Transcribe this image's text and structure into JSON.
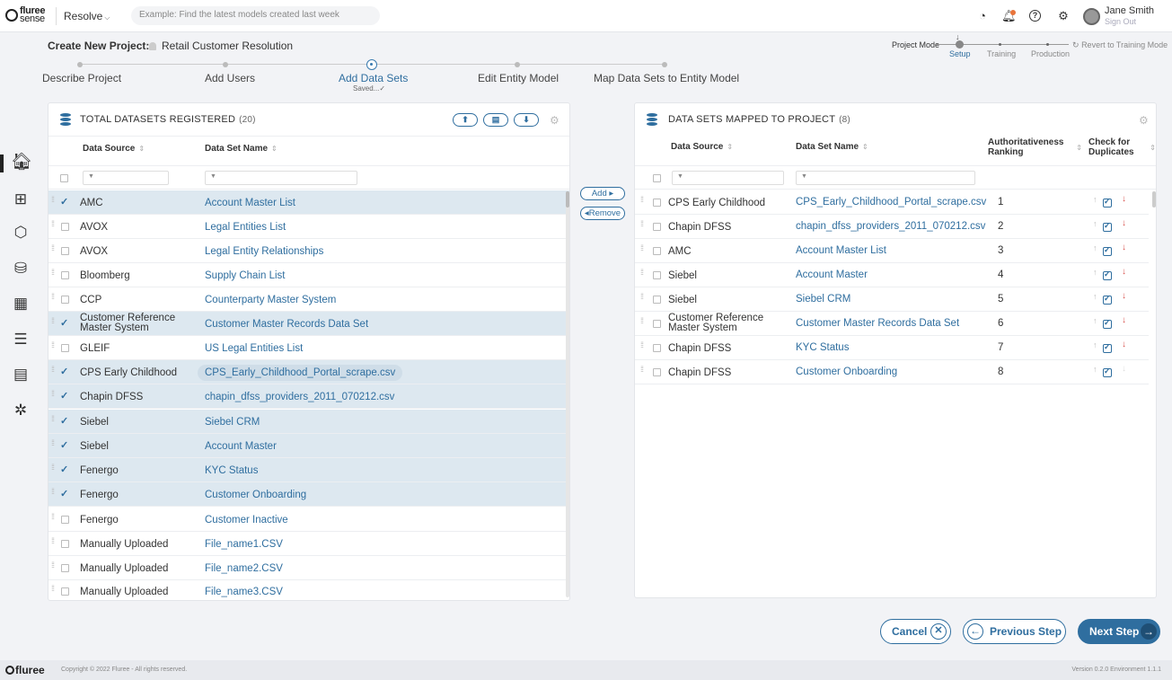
{
  "header": {
    "logo_line1": "fluree",
    "logo_line2": "sense",
    "app_name": "Resolve",
    "search_placeholder": "Example: Find the latest models created last week",
    "user_name": "Jane Smith",
    "sign_out": "Sign Out"
  },
  "project": {
    "title_label": "Create New Project:",
    "name": "Retail Customer Resolution",
    "mode_label": "Project Mode",
    "modes": [
      "Setup",
      "Training",
      "Production"
    ],
    "active_mode": "Setup",
    "revert_label": "Revert to Training Mode"
  },
  "stepper": {
    "steps": [
      "Describe Project",
      "Add Users",
      "Add Data Sets",
      "Edit Entity Model",
      "Map Data Sets to Entity Model"
    ],
    "active_step": "Add Data Sets",
    "active_status": "Saved..."
  },
  "sidebar": {
    "items": [
      "home-icon",
      "grid-icon",
      "cube-icon",
      "database-icon",
      "calculator-icon",
      "checklist-icon",
      "table-icon",
      "settings-icon"
    ],
    "active": "home-icon"
  },
  "left_panel": {
    "title": "TOTAL DATASETS REGISTERED",
    "count": "(20)",
    "columns": [
      "Data Source",
      "Data Set Name"
    ],
    "rows": [
      {
        "source": "AMC",
        "name": "Account Master List",
        "checked": true,
        "selected": true
      },
      {
        "source": "AVOX",
        "name": "Legal Entities List",
        "checked": false,
        "selected": false
      },
      {
        "source": "AVOX",
        "name": "Legal Entity Relationships",
        "checked": false,
        "selected": false
      },
      {
        "source": "Bloomberg",
        "name": "Supply Chain List",
        "checked": false,
        "selected": false
      },
      {
        "source": "CCP",
        "name": "Counterparty Master System",
        "checked": false,
        "selected": false
      },
      {
        "source": "Customer Reference Master System",
        "name": "Customer Master Records Data Set",
        "checked": true,
        "selected": true
      },
      {
        "source": "GLEIF",
        "name": "US Legal Entities List",
        "checked": false,
        "selected": false
      },
      {
        "source": "CPS Early Childhood",
        "name": "CPS_Early_Childhood_Portal_scrape.csv",
        "checked": true,
        "selected": true
      },
      {
        "source": "Chapin DFSS",
        "name": "chapin_dfss_providers_2011_070212.csv",
        "checked": true,
        "selected": true
      },
      {
        "source": "Siebel",
        "name": "Siebel CRM",
        "checked": true,
        "selected": true
      },
      {
        "source": "Siebel",
        "name": "Account Master",
        "checked": true,
        "selected": true
      },
      {
        "source": "Fenergo",
        "name": "KYC Status",
        "checked": true,
        "selected": true
      },
      {
        "source": "Fenergo",
        "name": "Customer Onboarding",
        "checked": true,
        "selected": true
      },
      {
        "source": "Fenergo",
        "name": "Customer Inactive",
        "checked": false,
        "selected": false
      },
      {
        "source": "Manually Uploaded",
        "name": "File_name1.CSV",
        "checked": false,
        "selected": false
      },
      {
        "source": "Manually Uploaded",
        "name": "File_name2.CSV",
        "checked": false,
        "selected": false
      },
      {
        "source": "Manually Uploaded",
        "name": "File_name3.CSV",
        "checked": false,
        "selected": false
      }
    ]
  },
  "transfer": {
    "add_label": "Add",
    "remove_label": "Remove"
  },
  "right_panel": {
    "title": "DATA SETS MAPPED TO PROJECT",
    "count": "(8)",
    "columns": [
      "Data Source",
      "Data Set Name",
      "Authoritativeness Ranking",
      "Check for Duplicates"
    ],
    "rows": [
      {
        "source": "CPS Early Childhood",
        "name": "CPS_Early_Childhood_Portal_scrape.csv",
        "rank": "1"
      },
      {
        "source": "Chapin DFSS",
        "name": "chapin_dfss_providers_2011_070212.csv",
        "rank": "2"
      },
      {
        "source": "AMC",
        "name": "Account Master List",
        "rank": "3"
      },
      {
        "source": "Siebel",
        "name": "Account Master",
        "rank": "4"
      },
      {
        "source": "Siebel",
        "name": "Siebel CRM",
        "rank": "5"
      },
      {
        "source": "Customer Reference Master System",
        "name": "Customer Master Records Data Set",
        "rank": "6"
      },
      {
        "source": "Chapin DFSS",
        "name": "KYC Status",
        "rank": "7"
      },
      {
        "source": "Chapin DFSS",
        "name": "Customer Onboarding",
        "rank": "8"
      }
    ]
  },
  "footer_buttons": {
    "cancel": "Cancel",
    "previous": "Previous Step",
    "next": "Next Step"
  },
  "bottom": {
    "brand": "fluree",
    "copyright": "Copyright © 2022 Fluree - All rights reserved.",
    "version": "Version 0.2.0   Environment 1.1.1"
  },
  "colors": {
    "accent": "#2f6e9f",
    "selected_row": "#dde8f0",
    "rank_down": "#d9534f"
  }
}
